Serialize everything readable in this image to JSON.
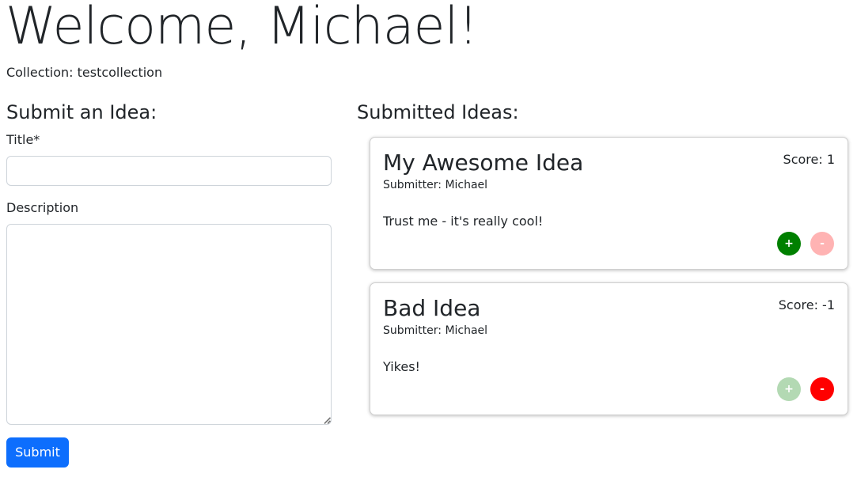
{
  "header": {
    "welcome": "Welcome, Michael!",
    "collection": "Collection: testcollection"
  },
  "submit_form": {
    "heading": "Submit an Idea:",
    "title_label": "Title*",
    "title_value": "",
    "description_label": "Description",
    "description_value": "",
    "submit_label": "Submit"
  },
  "ideas": {
    "heading": "Submitted Ideas:",
    "items": [
      {
        "title": "My Awesome Idea",
        "submitter": "Submitter: Michael",
        "score": "Score: 1",
        "description": "Trust me - it's really cool!",
        "upvote_label": "+",
        "downvote_label": "-",
        "vote_state": "upvoted"
      },
      {
        "title": "Bad Idea",
        "submitter": "Submitter: Michael",
        "score": "Score: -1",
        "description": "Yikes!",
        "upvote_label": "+",
        "downvote_label": "-",
        "vote_state": "downvoted"
      }
    ]
  },
  "colors": {
    "primary": "#0d6efd",
    "upvote_active": "#008000",
    "upvote_inactive": "#b3d9b3",
    "downvote_active": "#ff0000",
    "downvote_inactive": "#ffb3b3"
  }
}
